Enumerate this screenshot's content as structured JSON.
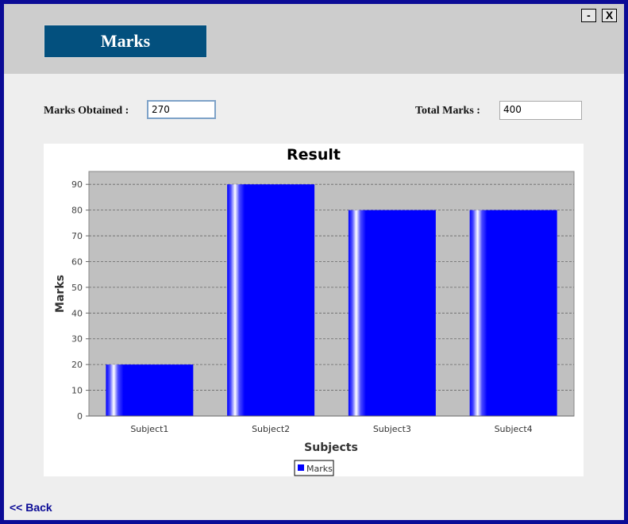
{
  "window": {
    "title": "Marks",
    "minimize_label": "-",
    "close_label": "X",
    "border_color": "#0b0b96",
    "header_color": "#cdcdcd",
    "title_badge_color": "#03507e"
  },
  "form": {
    "marks_obtained_label": "Marks Obtained :",
    "marks_obtained_value": "270",
    "total_marks_label": "Total Marks :",
    "total_marks_value": "400"
  },
  "chart_data": {
    "type": "bar",
    "title": "Result",
    "xlabel": "Subjects",
    "ylabel": "Marks",
    "categories": [
      "Subject1",
      "Subject2",
      "Subject3",
      "Subject4"
    ],
    "series": [
      {
        "name": "Marks",
        "values": [
          20,
          90,
          80,
          80
        ],
        "color": "#0000ff"
      }
    ],
    "ylim": [
      0,
      95
    ],
    "yticks": [
      0,
      10,
      20,
      30,
      40,
      50,
      60,
      70,
      80,
      90
    ],
    "grid": true,
    "plot_background": "#c0c0c0",
    "legend_position": "bottom-center"
  },
  "footer": {
    "back_label": "<< Back"
  }
}
